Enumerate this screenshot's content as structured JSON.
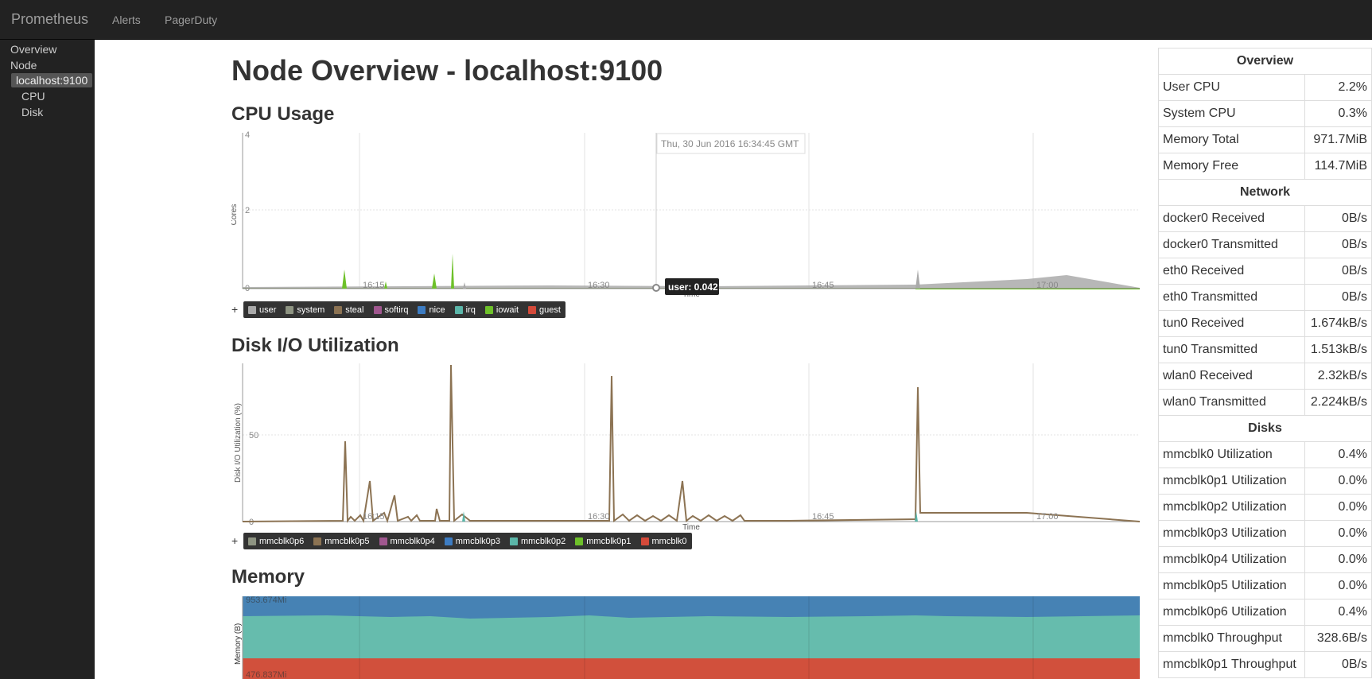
{
  "navbar": {
    "brand": "Prometheus",
    "links": [
      "Alerts",
      "PagerDuty"
    ]
  },
  "sidebar": {
    "items": [
      "Overview",
      "Node",
      "localhost:9100",
      "CPU",
      "Disk"
    ]
  },
  "page_title": "Node Overview - localhost:9100",
  "sections": {
    "cpu": "CPU Usage",
    "disk": "Disk I/O Utilization",
    "memory": "Memory"
  },
  "cpu_chart": {
    "ylabel": "Cores",
    "xlabel": "Time",
    "y_ticks": [
      "4",
      "2",
      "0"
    ],
    "x_ticks": [
      "16:15",
      "16:30",
      "16:45",
      "17:00"
    ],
    "hover_time": "Thu, 30 Jun 2016 16:34:45 GMT",
    "hover_value": "user: 0.042",
    "legend": [
      {
        "name": "user",
        "color": "#aaaaaa"
      },
      {
        "name": "system",
        "color": "#8e9482"
      },
      {
        "name": "steal",
        "color": "#8c7353"
      },
      {
        "name": "softirq",
        "color": "#a0578f"
      },
      {
        "name": "nice",
        "color": "#3d7cc2"
      },
      {
        "name": "irq",
        "color": "#5bb6a9"
      },
      {
        "name": "iowait",
        "color": "#6ec12a"
      },
      {
        "name": "guest",
        "color": "#d44a3a"
      }
    ]
  },
  "disk_chart": {
    "ylabel": "Disk I/O Utilization (%)",
    "xlabel": "Time",
    "y_ticks": [
      "50",
      "0"
    ],
    "x_ticks": [
      "16:15",
      "16:30",
      "16:45",
      "17:00"
    ],
    "legend": [
      {
        "name": "mmcblk0p6",
        "color": "#8e9482"
      },
      {
        "name": "mmcblk0p5",
        "color": "#8c7353"
      },
      {
        "name": "mmcblk0p4",
        "color": "#a0578f"
      },
      {
        "name": "mmcblk0p3",
        "color": "#3d7cc2"
      },
      {
        "name": "mmcblk0p2",
        "color": "#5bb6a9"
      },
      {
        "name": "mmcblk0p1",
        "color": "#6ec12a"
      },
      {
        "name": "mmcblk0",
        "color": "#d44a3a"
      }
    ]
  },
  "memory_chart": {
    "ylabel": "Memory (B)",
    "y_ticks": [
      "953.674Mi",
      "476.837Mi"
    ],
    "colors": {
      "top": "#4682b4",
      "middle": "#66bcad",
      "bottom": "#d1503c"
    }
  },
  "stats": [
    {
      "header": "Overview"
    },
    {
      "label": "User CPU",
      "value": "2.2%"
    },
    {
      "label": "System CPU",
      "value": "0.3%"
    },
    {
      "label": "Memory Total",
      "value": "971.7MiB"
    },
    {
      "label": "Memory Free",
      "value": "114.7MiB"
    },
    {
      "header": "Network"
    },
    {
      "label": "docker0 Received",
      "value": "0B/s"
    },
    {
      "label": "docker0 Transmitted",
      "value": "0B/s"
    },
    {
      "label": "eth0 Received",
      "value": "0B/s"
    },
    {
      "label": "eth0 Transmitted",
      "value": "0B/s"
    },
    {
      "label": "tun0 Received",
      "value": "1.674kB/s"
    },
    {
      "label": "tun0 Transmitted",
      "value": "1.513kB/s"
    },
    {
      "label": "wlan0 Received",
      "value": "2.32kB/s"
    },
    {
      "label": "wlan0 Transmitted",
      "value": "2.224kB/s"
    },
    {
      "header": "Disks"
    },
    {
      "label": "mmcblk0 Utilization",
      "value": "0.4%"
    },
    {
      "label": "mmcblk0p1 Utilization",
      "value": "0.0%"
    },
    {
      "label": "mmcblk0p2 Utilization",
      "value": "0.0%"
    },
    {
      "label": "mmcblk0p3 Utilization",
      "value": "0.0%"
    },
    {
      "label": "mmcblk0p4 Utilization",
      "value": "0.0%"
    },
    {
      "label": "mmcblk0p5 Utilization",
      "value": "0.0%"
    },
    {
      "label": "mmcblk0p6 Utilization",
      "value": "0.4%"
    },
    {
      "label": "mmcblk0 Throughput",
      "value": "328.6B/s"
    },
    {
      "label": "mmcblk0p1 Throughput",
      "value": "0B/s"
    }
  ]
}
